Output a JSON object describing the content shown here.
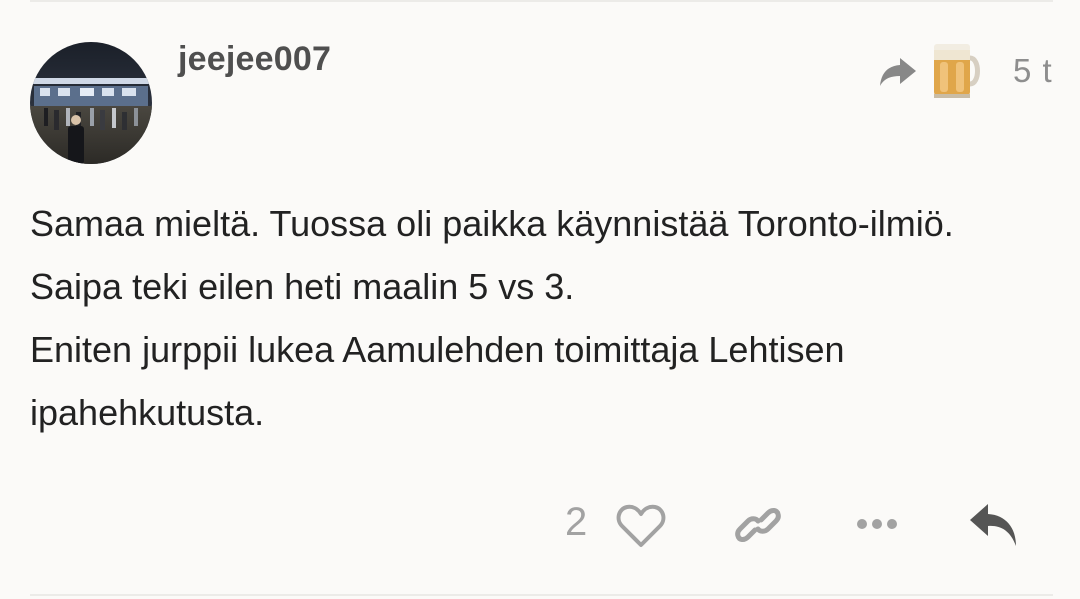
{
  "post": {
    "username": "jeejee007",
    "age": "5 t",
    "paragraphs": [
      "Samaa mieltä. Tuossa oli paikka käynnistää Toronto-ilmiö. Saipa teki eilen heti maalin 5 vs 3.",
      "Eniten jurppii lukea Aamulehden toimittaja Lehtisen ipahehkutusta."
    ],
    "like_count": "2"
  },
  "icons": {
    "avatar": "user-avatar-photo",
    "reply_to": "share-arrow-icon",
    "reply_to_avatar": "beer-mug-avatar",
    "like": "heart-icon",
    "link": "link-icon",
    "more": "more-dots-icon",
    "reply": "reply-icon"
  },
  "colors": {
    "background": "#fbfaf8",
    "text": "#222222",
    "username": "#4f4f4f",
    "muted": "#8e8e8e",
    "action_icon": "#a2a2a2",
    "reply_icon": "#555555"
  }
}
